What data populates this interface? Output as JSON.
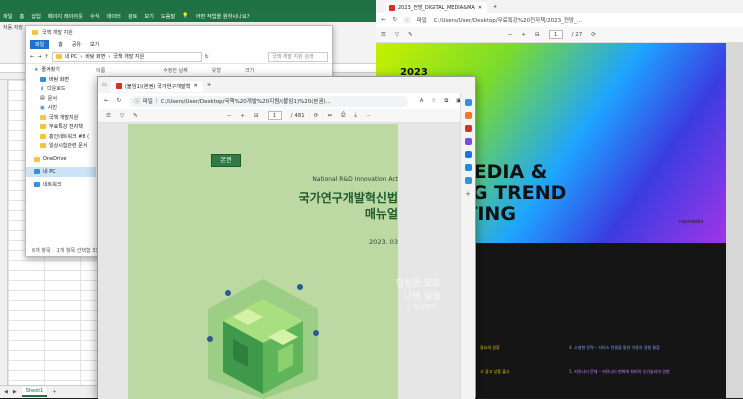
{
  "excel": {
    "menu": [
      "파일",
      "홈",
      "삽입",
      "페이지 레이아웃",
      "수식",
      "데이터",
      "검토",
      "보기",
      "도움말",
      "어떤 작업을 원하시나요?"
    ],
    "autosave": "자동 저장",
    "name_box": "",
    "sheet_tab": "Sheet1",
    "add_sheet": "+",
    "colors": {
      "accent": "#217346"
    }
  },
  "explorer": {
    "title": "국책 개발 지원",
    "ribbon_tabs": [
      "파일",
      "홈",
      "공유",
      "보기"
    ],
    "breadcrumb": [
      "내 PC",
      "바탕 화면",
      "국책 개발 지원"
    ],
    "search_placeholder": "국책 개발 지원 검색",
    "columns": [
      "이름",
      "수정한 날짜",
      "유형",
      "크기"
    ],
    "nav": [
      {
        "label": "즐겨찾기",
        "icon": "star-icon",
        "sub": false
      },
      {
        "label": "바탕 화면",
        "icon": "desktop-icon",
        "sub": true
      },
      {
        "label": "다운로드",
        "icon": "download-icon",
        "sub": true
      },
      {
        "label": "문서",
        "icon": "document-icon",
        "sub": true
      },
      {
        "label": "사진",
        "icon": "picture-icon",
        "sub": true
      },
      {
        "label": "국책 개발지원",
        "icon": "folder-icon",
        "sub": true
      },
      {
        "label": "무료특강 전자책",
        "icon": "folder-icon",
        "sub": true
      },
      {
        "label": "홍인네트워크 #8 (",
        "icon": "folder-icon",
        "sub": true
      },
      {
        "label": "일상시험관련 문서",
        "icon": "folder-icon",
        "sub": true
      },
      {
        "label": "OneDrive",
        "icon": "cloud-icon",
        "sub": false
      },
      {
        "label": "내 PC",
        "icon": "pc-icon",
        "sub": false,
        "selected": true
      },
      {
        "label": "네트워크",
        "icon": "network-icon",
        "sub": false
      }
    ],
    "status": [
      "6개 항목",
      "1개 항목 선택함 33"
    ]
  },
  "edge_back": {
    "tab_title": "2023_전망_DIGITAL_MEDIA&MA",
    "url": "C:/Users/User/Desktop/무료특강%20전자책/2023_전망_...",
    "url_scheme": "파일",
    "page": "1",
    "page_total": "/ 27",
    "slide": {
      "year": "2023",
      "line1": "L MEDIA &",
      "line2": "TING TREND",
      "line3": "ASTING",
      "brand": "nasmedia"
    },
    "slide2": {
      "item1": "중요의 성장",
      "item2": "4. 소셜형 전략 – 서비스 연결을 통한 이용자 경험 통합",
      "item3": "고 광고 상품 출시",
      "item4": "5. 커뮤니티 문제 – 커뮤니티 변화에 회피하 신기술과의 경험"
    }
  },
  "edge_front": {
    "tab_title": "(붙임1)(본권) 국가연구개발혁",
    "new_tab": "+",
    "url_scheme": "파일",
    "url": "C:/Users/User/Desktop/국책%20개발%20지원/(붙임1)%20(본권)...",
    "page": "1",
    "page_total": "/ 481",
    "zoom_minus": "−",
    "zoom_plus": "+",
    "cover": {
      "tag": "본권",
      "en_title": "National R&D Innovation Act",
      "title1": "국가연구개발혁신법",
      "title2": "매뉴얼",
      "date": "2023. 03"
    },
    "overlay": {
      "l1": "당신은 모르",
      "l2": "나의 일상",
      "l3": "◎ 두나무기"
    }
  }
}
